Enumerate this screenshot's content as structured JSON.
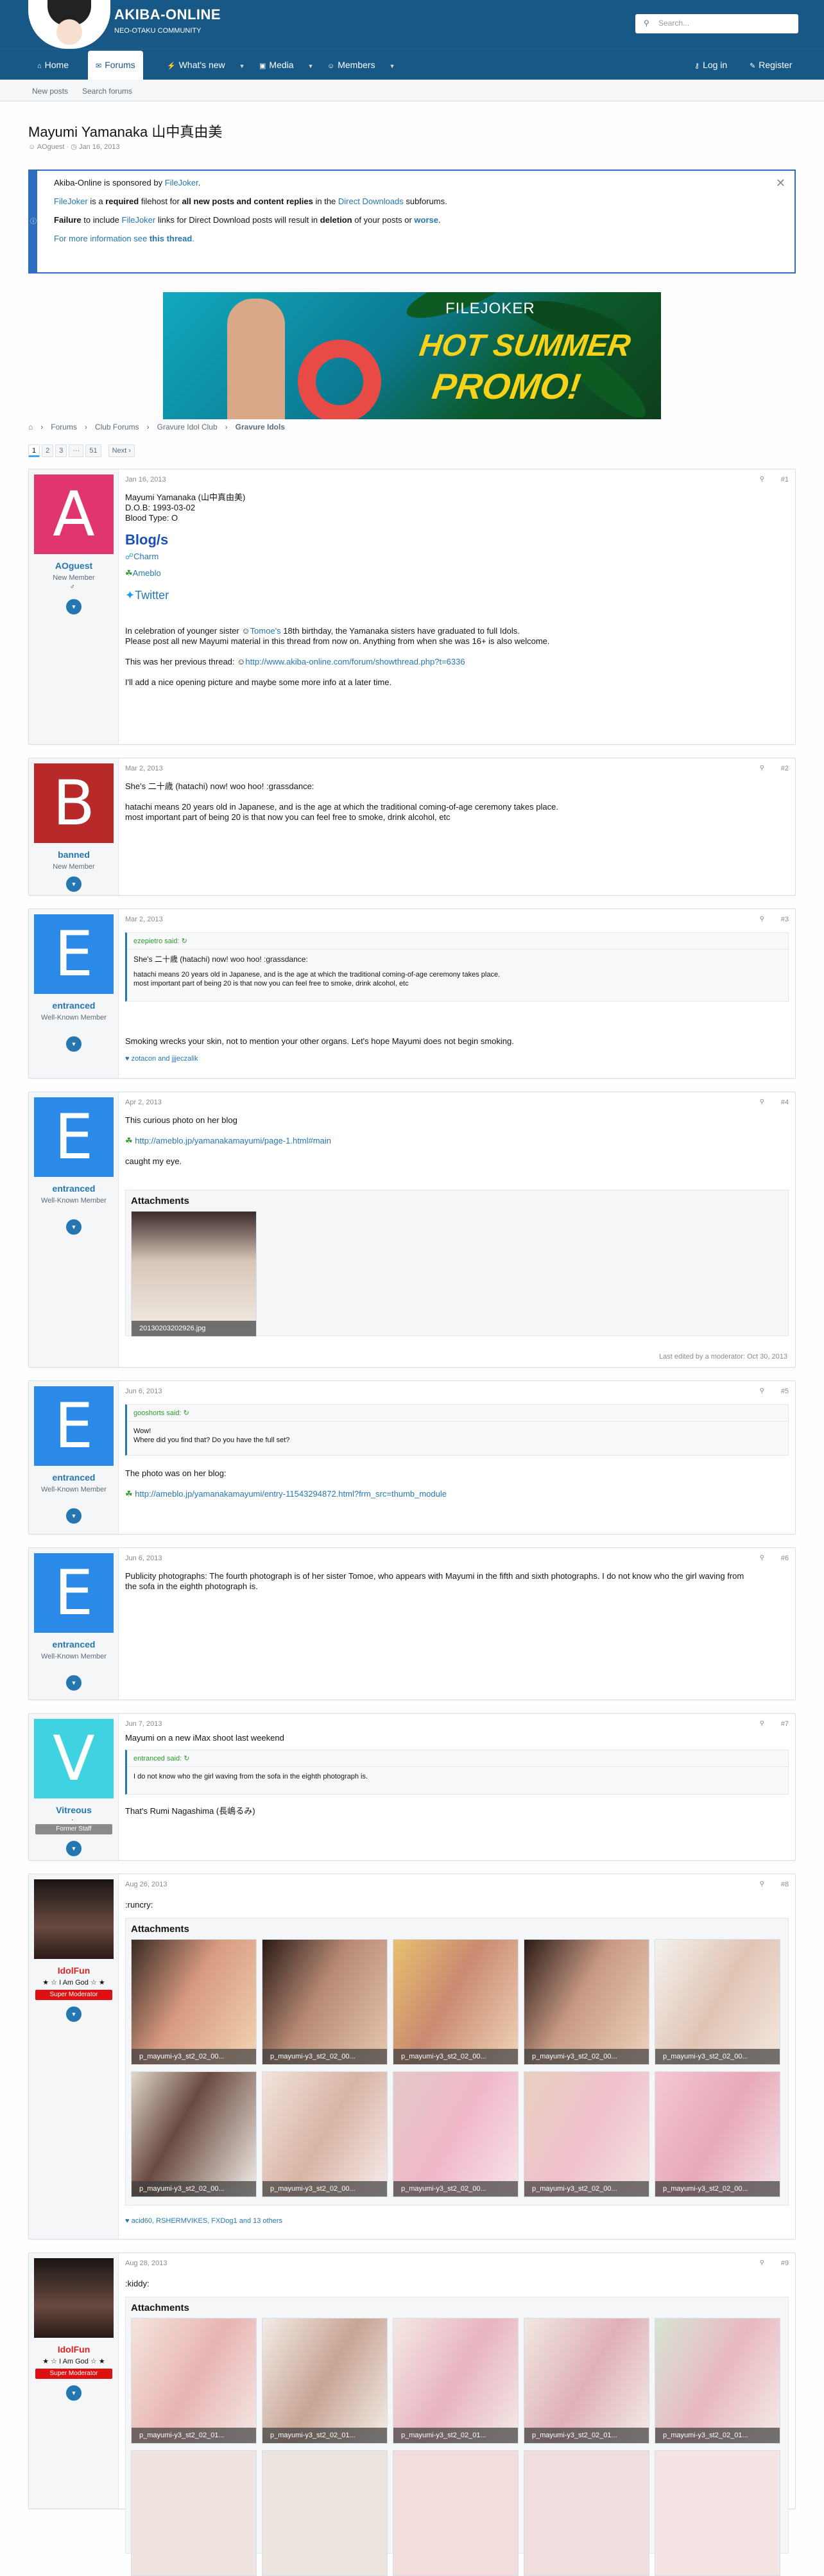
{
  "site": {
    "title": "AKIBA-ONLINE",
    "subtitle": "NEO-OTAKU COMMUNITY",
    "search_placeholder": "Search..."
  },
  "nav": {
    "home": "Home",
    "forums": "Forums",
    "whats_new": "What's new",
    "media": "Media",
    "members": "Members",
    "login": "Log in",
    "register": "Register"
  },
  "subnav": {
    "new_posts": "New posts",
    "search_forums": "Search forums"
  },
  "thread": {
    "title": "Mayumi Yamanaka 山中真由美",
    "author": "AOguest",
    "date": "Jan 16, 2013"
  },
  "notice": {
    "l1a": "Akiba-Online is sponsored by ",
    "l1b": "FileJoker",
    "l1c": ".",
    "l2a": "FileJoker",
    "l2b": " is a ",
    "l2c": "required",
    "l2d": " filehost for ",
    "l2e": "all new posts and content replies",
    "l2f": " in the ",
    "l2g": "Direct Downloads",
    "l2h": " subforums.",
    "l3a": "Failure",
    "l3b": " to include ",
    "l3c": "FileJoker",
    "l3d": " links for Direct Download posts will result in ",
    "l3e": "deletion",
    "l3f": " of your posts or ",
    "l3g": "worse",
    "l3h": ".",
    "l4a": "For more information see ",
    "l4b": "this thread",
    "l4c": "."
  },
  "banner": {
    "brand": "FILEJOKER",
    "hot": "HOT SUMMER",
    "promo": "PROMO!"
  },
  "breadcrumb": [
    "Forums",
    "Club Forums",
    "Gravure Idol Club",
    "Gravure Idols"
  ],
  "pager": {
    "p1": "1",
    "p2": "2",
    "p3": "3",
    "dots": "···",
    "last": "51",
    "next": "Next ›"
  },
  "posts": [
    {
      "user": "AOguest",
      "title": "New Member",
      "date": "Jan 16, 2013",
      "num": "#1",
      "avatar": "A",
      "lines": [
        "Mayumi Yamanaka (山中真由美)",
        "D.O.B: 1993-03-02",
        "Blood Type: O"
      ],
      "blog_h": "Blog/s",
      "charm": "Charm",
      "ameblo": "Ameblo",
      "twitter": "Twitter",
      "p1a": "In celebration of younger sister ",
      "p1b": "Tomoe's",
      "p1c": " 18th birthday, the Yamanaka sisters have graduated to full Idols.",
      "p1d": "Please post all new Mayumi material in this thread from now on. Anything from when she was 16+ is also welcome.",
      "p2a": "This was her previous thread: ",
      "p2b": "http://www.akiba-online.com/forum/showthread.php?t=6336",
      "p3": "I'll add a nice opening picture and maybe some more info at a later time."
    },
    {
      "user": "banned",
      "title": "New Member",
      "date": "Mar 2, 2013",
      "num": "#2",
      "avatar": "B",
      "l1": "She's 二十歳 (hatachi) now! woo hoo! :grassdance:",
      "l2": "hatachi means 20 years old in Japanese, and is the age at which the traditional coming-of-age ceremony takes place.",
      "l3": "most important part of being 20 is that now you can feel free to smoke, drink alcohol, etc"
    },
    {
      "user": "entranced",
      "title": "Well-Known Member",
      "date": "Mar 2, 2013",
      "num": "#3",
      "avatar": "E",
      "quote_by": "ezepietro said:",
      "q1": "She's 二十歳 (hatachi) now! woo hoo! :grassdance:",
      "q2": "hatachi means 20 years old in Japanese, and is the age at which the traditional coming-of-age ceremony takes place.",
      "q3": "most important part of being 20 is that now you can feel free to smoke, drink alcohol, etc",
      "body": "Smoking wrecks your skin, not to mention your other organs. Let's hope Mayumi does not begin smoking.",
      "reacts": "zotacon and jjjeczalik"
    },
    {
      "user": "entranced",
      "title": "Well-Known Member",
      "date": "Apr 2, 2013",
      "num": "#4",
      "avatar": "E",
      "l1": "This curious photo on her blog",
      "link": "http://ameblo.jp/yamanakamayumi/page-1.html#main",
      "l2": "caught my eye.",
      "att_title": "Attachments",
      "att": "20130203202926.jpg",
      "edited": "Last edited by a moderator: Oct 30, 2013"
    },
    {
      "user": "entranced",
      "title": "Well-Known Member",
      "date": "Jun 6, 2013",
      "num": "#5",
      "avatar": "E",
      "quote_by": "gooshorts said:",
      "q1": "Wow!",
      "q2": "Where did you find that? Do you have the full set?",
      "l1": "The photo was on her blog:",
      "link": "http://ameblo.jp/yamanakamayumi/entry-11543294872.html?frm_src=thumb_module"
    },
    {
      "user": "entranced",
      "title": "Well-Known Member",
      "date": "Jun 6, 2013",
      "num": "#6",
      "avatar": "E",
      "body": "Publicity photographs: The fourth photograph is of her sister Tomoe, who appears with Mayumi in the fifth and sixth photographs. I do not know who the girl waving from the sofa in the eighth photograph is."
    },
    {
      "user": "Vitreous",
      "title": "Former Staff",
      "date": "Jun 7, 2013",
      "num": "#7",
      "avatar": "V",
      "l1": "Mayumi on a new iMax shoot last weekend",
      "quote_by": "entranced said:",
      "q1": "I do not know who the girl waving from the sofa in the eighth photograph is.",
      "l2": "That's Rumi Nagashima (長嶋るみ)"
    },
    {
      "user": "IdolFun",
      "title": "★ ☆ I Am God ☆ ★",
      "badge": "Super Moderator",
      "date": "Aug 26, 2013",
      "num": "#8",
      "body": ":runcry:",
      "att_title": "Attachments",
      "thumb": "p_mayumi-y3_st2_02_00...",
      "reacts": "acid60, RSHERMVIKES, FXDog1 and 13 others"
    },
    {
      "user": "IdolFun",
      "title": "★ ☆ I Am God ☆ ★",
      "badge": "Super Moderator",
      "date": "Aug 28, 2013",
      "num": "#9",
      "body": ":kiddy:",
      "att_title": "Attachments",
      "thumb": "p_mayumi-y3_st2_02_01..."
    }
  ],
  "colors": {
    "header": "#185886",
    "link": "#2577b1",
    "accent": "#47a7eb"
  }
}
